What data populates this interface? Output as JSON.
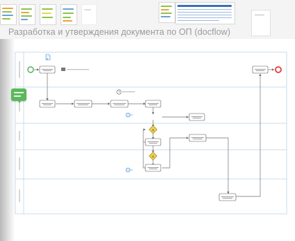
{
  "page": {
    "title": "Разработка и утверждения документа по ОП (docflow)"
  },
  "colors": {
    "lane_border": "#c9dced",
    "flow_line": "#6e6e6e",
    "start_event": "#4caf50",
    "end_event": "#e53935",
    "gateway": "#f0d24c",
    "tag": "#5cb85c",
    "link": "#4a90d9"
  },
  "icons": [
    "timer-icon",
    "message-icon",
    "document-icon",
    "tag-icon"
  ]
}
